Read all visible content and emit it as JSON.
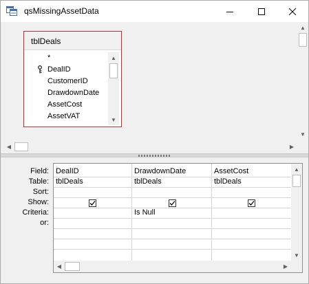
{
  "window": {
    "title": "qsMissingAssetData"
  },
  "table_box": {
    "name": "tblDeals",
    "fields": [
      "*",
      "DealID",
      "CustomerID",
      "DrawdownDate",
      "AssetCost",
      "AssetVAT"
    ],
    "primary_key_field": "DealID"
  },
  "grid": {
    "row_labels": [
      "Field:",
      "Table:",
      "Sort:",
      "Show:",
      "Criteria:",
      "or:"
    ],
    "columns": [
      {
        "field": "DealID",
        "table": "tblDeals",
        "sort": "",
        "show": true,
        "criteria": "",
        "or": ""
      },
      {
        "field": "DrawdownDate",
        "table": "tblDeals",
        "sort": "",
        "show": true,
        "criteria": "Is Null",
        "or": ""
      },
      {
        "field": "AssetCost",
        "table": "tblDeals",
        "sort": "",
        "show": true,
        "criteria": "",
        "or": ""
      }
    ]
  },
  "icons": {
    "app": "query-icon",
    "minimize": "minimize-icon",
    "maximize": "maximize-icon",
    "close": "close-icon",
    "key": "primary-key-icon",
    "check": "check-icon"
  },
  "colors": {
    "table_border": "#a33a3a",
    "pane_background": "#f0f0f0"
  }
}
